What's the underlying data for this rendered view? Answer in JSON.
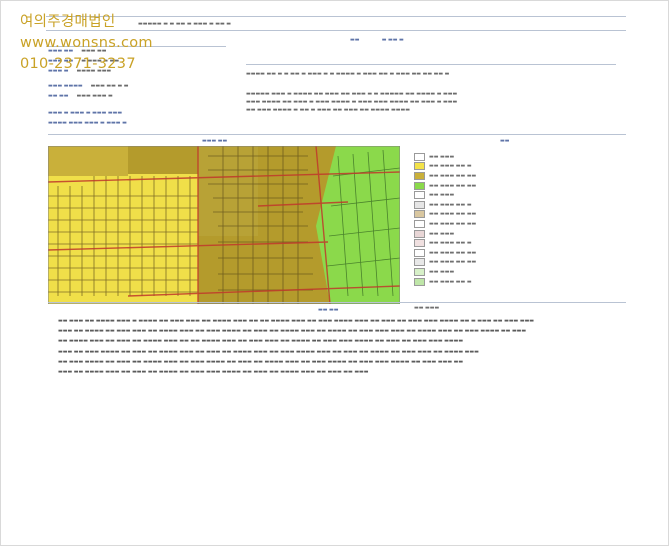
{
  "watermark": {
    "name": "여의주경매법인",
    "url": "www.wonsns.com",
    "phone": "010-2371-3237"
  },
  "colors": {
    "watermark": "#c9a227",
    "zone_yellow": "#f2e24a",
    "zone_olive": "#b49b2c",
    "zone_green": "#8bd94b",
    "road_red": "#c0392b",
    "link_blue": "#5f74a8"
  },
  "legend_items": [
    {
      "label": "",
      "color": "#ffffff"
    },
    {
      "label": "",
      "color": "#f2e24a"
    },
    {
      "label": "",
      "color": "#c9b03a"
    },
    {
      "label": "",
      "color": "#8bd94b"
    },
    {
      "label": "",
      "color": "#ffffff"
    },
    {
      "label": "",
      "color": "#e6e6e6"
    },
    {
      "label": "",
      "color": "#d9c7a0"
    },
    {
      "label": "",
      "color": "#ffffff"
    },
    {
      "label": "",
      "color": "#e8d6d6"
    },
    {
      "label": "",
      "color": "#f0e0e0"
    },
    {
      "label": "",
      "color": "#ffffff"
    },
    {
      "label": "",
      "color": "#e8e8e8"
    },
    {
      "label": "",
      "color": "#d7f0c8"
    },
    {
      "label": "",
      "color": "#bfe6a8"
    }
  ]
}
